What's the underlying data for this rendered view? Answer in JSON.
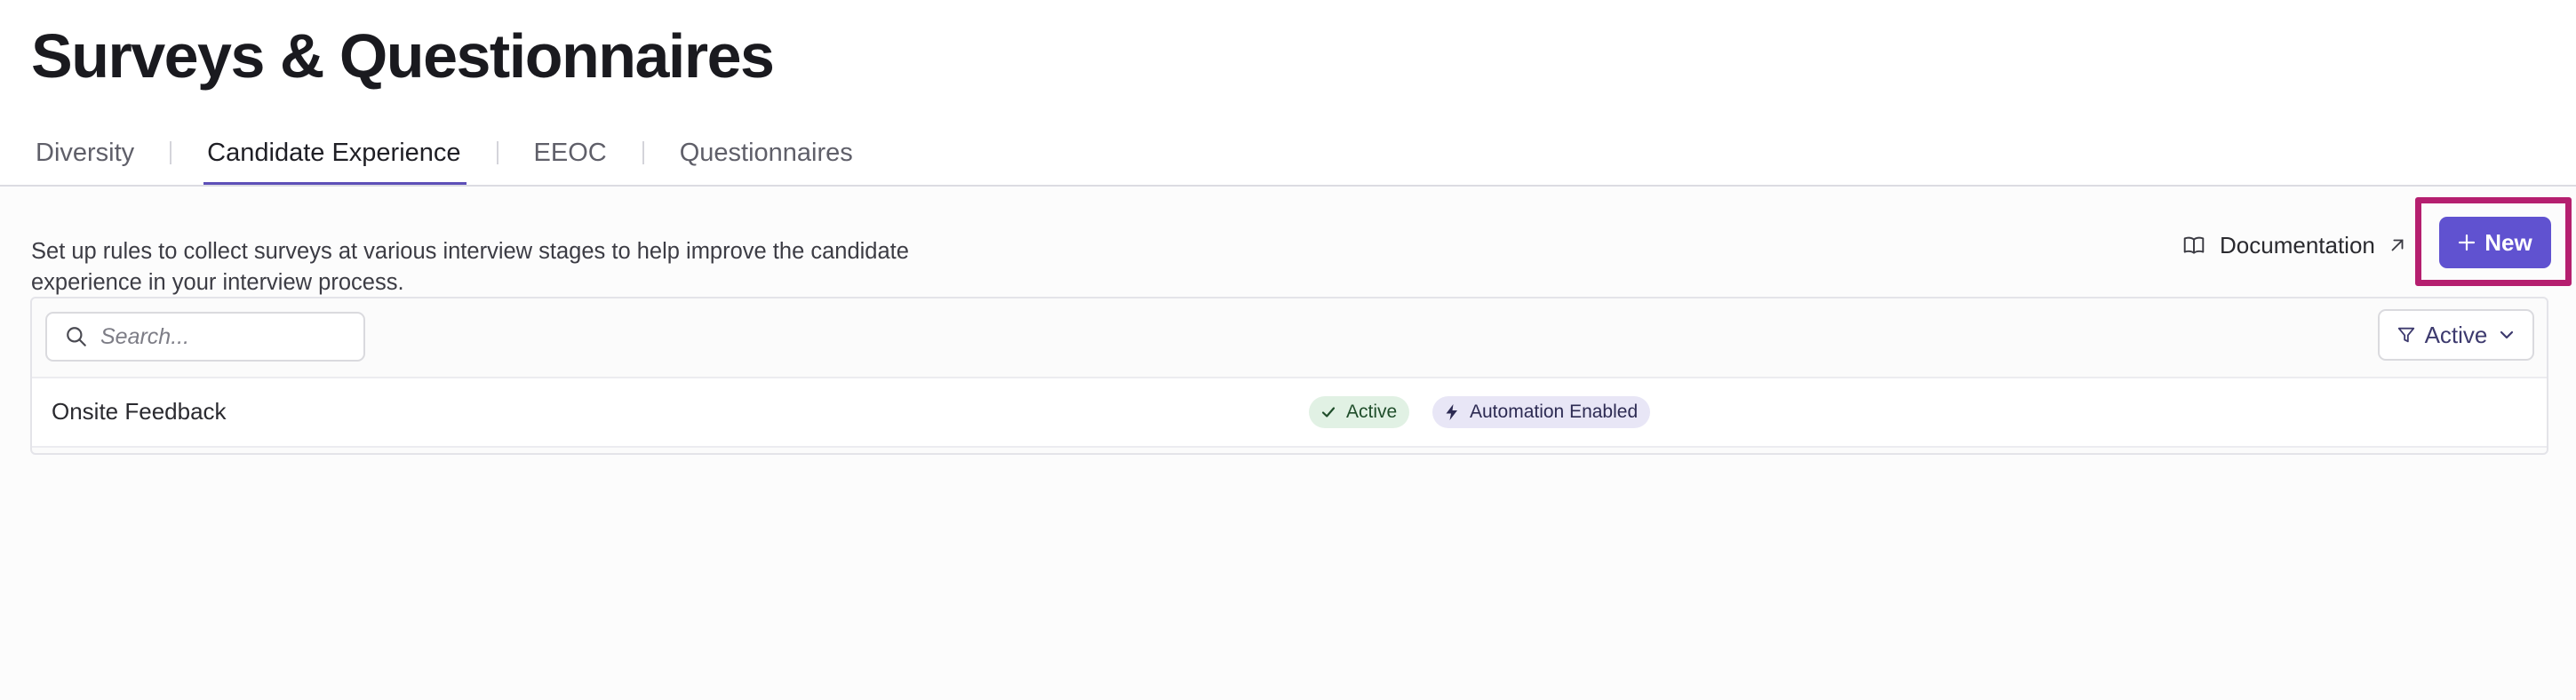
{
  "page": {
    "title": "Surveys & Questionnaires"
  },
  "tabs": [
    {
      "label": "Diversity",
      "active": false
    },
    {
      "label": "Candidate Experience",
      "active": true
    },
    {
      "label": "EEOC",
      "active": false
    },
    {
      "label": "Questionnaires",
      "active": false
    }
  ],
  "description": "Set up rules to collect surveys at various interview stages to help improve the candidate experience in your interview process.",
  "header_actions": {
    "documentation_label": "Documentation",
    "documentation_icon": "book-open-icon",
    "external_icon": "arrow-up-right-icon",
    "new_label": "New",
    "new_icon": "plus-icon"
  },
  "toolbar": {
    "search_placeholder": "Search...",
    "search_value": "",
    "filter_label": "Active",
    "filter_icon": "funnel-icon"
  },
  "table": {
    "rows": [
      {
        "name": "Onsite Feedback",
        "status_badge": "Active",
        "automation_badge": "Automation Enabled"
      }
    ]
  },
  "colors": {
    "primary": "#6052d0",
    "tab_underline": "#5d4fb8",
    "highlight_frame": "#b51f6f",
    "active_badge_bg": "#e1f1e4",
    "automation_badge_bg": "#e8e6f6"
  }
}
